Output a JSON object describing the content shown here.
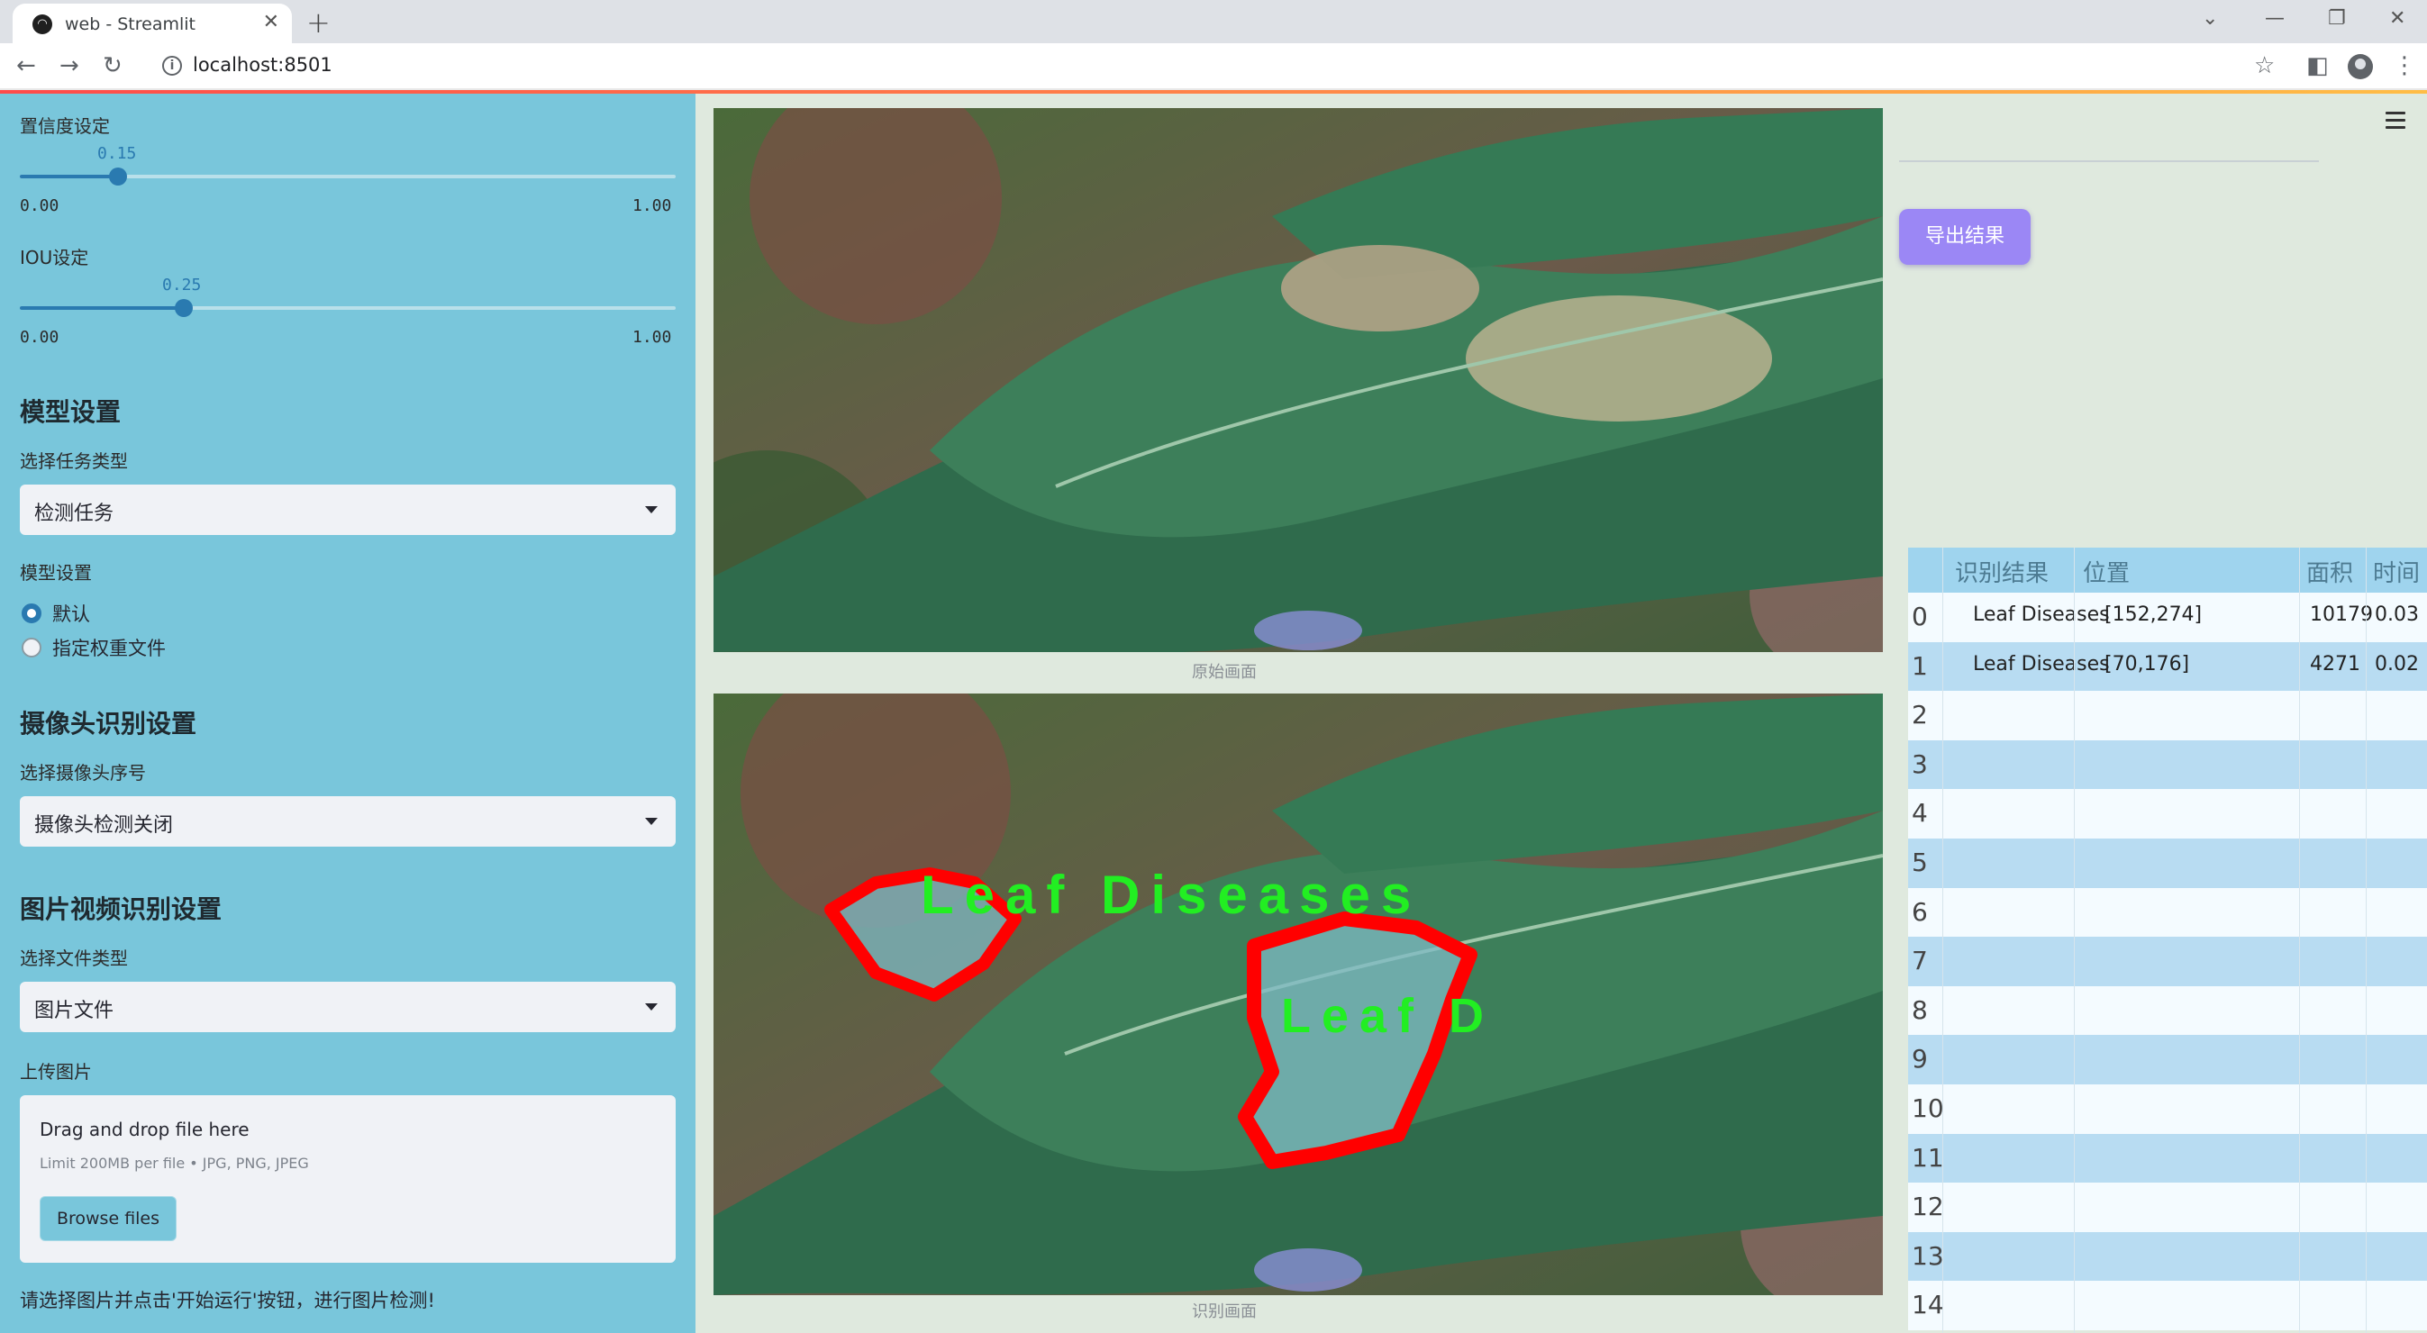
{
  "browser": {
    "tab_title": "web - Streamlit",
    "url": "localhost:8501"
  },
  "sidebar": {
    "confidence": {
      "label": "置信度设定",
      "value": "0.15",
      "min": "0.00",
      "max": "1.00",
      "fraction": 0.15
    },
    "iou": {
      "label": "IOU设定",
      "value": "0.25",
      "min": "0.00",
      "max": "1.00",
      "fraction": 0.25
    },
    "model_heading": "模型设置",
    "task_label": "选择任务类型",
    "task_value": "检测任务",
    "model_label": "模型设置",
    "model_options": [
      "默认",
      "指定权重文件"
    ],
    "model_selected": "默认",
    "camera_heading": "摄像头识别设置",
    "camera_label": "选择摄像头序号",
    "camera_value": "摄像头检测关闭",
    "media_heading": "图片视频识别设置",
    "file_type_label": "选择文件类型",
    "file_type_value": "图片文件",
    "upload_label": "上传图片",
    "upload_main": "Drag and drop file here",
    "upload_sub": "Limit 200MB per file • JPG, PNG, JPEG",
    "browse_label": "Browse files",
    "footer": "请选择图片并点击'开始运行'按钮，进行图片检测!"
  },
  "main": {
    "original_caption": "原始画面",
    "result_caption": "识别画面",
    "overlay_label": "Leaf Diseases",
    "overlay_label_2": "Leaf D"
  },
  "right": {
    "export_label": "导出结果",
    "table": {
      "columns": [
        "识别结果",
        "位置",
        "面积",
        "时间"
      ],
      "rows": [
        {
          "index": "0",
          "result": "Leaf Diseases",
          "position": "[152,274]",
          "area": "10179",
          "time": "0.03"
        },
        {
          "index": "1",
          "result": "Leaf Diseases",
          "position": "[70,176]",
          "area": "4271",
          "time": "0.02"
        },
        {
          "index": "2",
          "result": "",
          "position": "",
          "area": "",
          "time": ""
        },
        {
          "index": "3",
          "result": "",
          "position": "",
          "area": "",
          "time": ""
        },
        {
          "index": "4",
          "result": "",
          "position": "",
          "area": "",
          "time": ""
        },
        {
          "index": "5",
          "result": "",
          "position": "",
          "area": "",
          "time": ""
        },
        {
          "index": "6",
          "result": "",
          "position": "",
          "area": "",
          "time": ""
        },
        {
          "index": "7",
          "result": "",
          "position": "",
          "area": "",
          "time": ""
        },
        {
          "index": "8",
          "result": "",
          "position": "",
          "area": "",
          "time": ""
        },
        {
          "index": "9",
          "result": "",
          "position": "",
          "area": "",
          "time": ""
        },
        {
          "index": "10",
          "result": "",
          "position": "",
          "area": "",
          "time": ""
        },
        {
          "index": "11",
          "result": "",
          "position": "",
          "area": "",
          "time": ""
        },
        {
          "index": "12",
          "result": "",
          "position": "",
          "area": "",
          "time": ""
        },
        {
          "index": "13",
          "result": "",
          "position": "",
          "area": "",
          "time": ""
        },
        {
          "index": "14",
          "result": "",
          "position": "",
          "area": "",
          "time": ""
        }
      ]
    }
  },
  "colors": {
    "sidebar_bg": "#79c6db",
    "slider_accent": "#2a7ab0",
    "export_button": "#9b87f5",
    "detection_outline": "#ff0000",
    "detection_text": "#22ee22"
  },
  "icons": [
    "streamlit-favicon",
    "close-icon",
    "plus-icon",
    "back-icon",
    "forward-icon",
    "reload-icon",
    "info-icon",
    "star-icon",
    "sidebar-icon",
    "profile-icon",
    "menu-icon",
    "chevron-down-icon",
    "hamburger-icon"
  ]
}
